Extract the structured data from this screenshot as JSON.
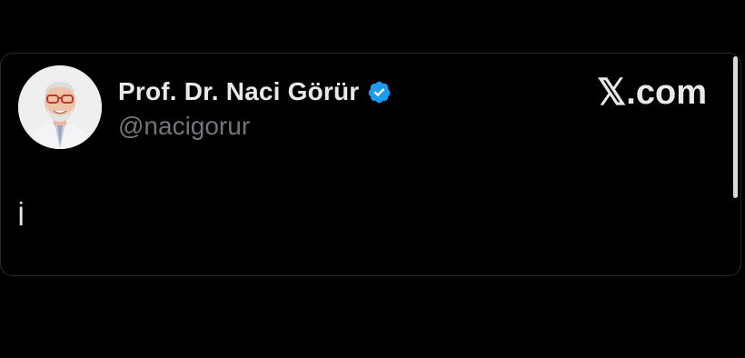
{
  "post": {
    "author_name": "Prof. Dr. Naci Görür",
    "author_handle": "@nacigorur",
    "verified": true,
    "verified_color": "#1d9bf0",
    "avatar_icon": "profile-photo",
    "body_text": "İ"
  },
  "brand": {
    "label": ".com",
    "icon": "x-logo-icon",
    "x_glyph": "𝕏"
  },
  "scroll_position": 0,
  "colors": {
    "background": "#000000",
    "text_primary": "#e7e9ea",
    "text_secondary": "#71767b",
    "border": "#2a2a2a"
  }
}
